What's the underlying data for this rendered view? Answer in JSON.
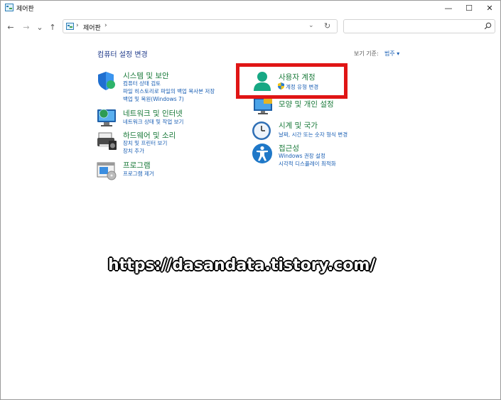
{
  "window": {
    "title": "제어판",
    "controls": {
      "minimize": "—",
      "maximize": "☐",
      "close": "✕"
    }
  },
  "nav": {
    "back": "←",
    "forward": "→",
    "recent": "⌄",
    "up": "↑"
  },
  "address": {
    "sep1": "›",
    "crumb": "제어판",
    "sep2": "›",
    "dropdown": "⌄",
    "refresh": "↻"
  },
  "search": {
    "placeholder": ""
  },
  "main": {
    "title": "컴퓨터 설정 변경",
    "view_by_label": "보기 기준:",
    "view_by_value": "범주 ▾"
  },
  "categories": {
    "system": {
      "title": "시스템 및 보안",
      "links": [
        "컴퓨터 상태 검토",
        "파일 히스토리로 파일의 백업 복사본 저장",
        "백업 및 복원(Windows 7)"
      ]
    },
    "network": {
      "title": "네트워크 및 인터넷",
      "links": [
        "네트워크 상태 및 작업 보기"
      ]
    },
    "hardware": {
      "title": "하드웨어 및 소리",
      "links": [
        "장치 및 프린터 보기",
        "장치 추가"
      ]
    },
    "programs": {
      "title": "프로그램",
      "links": [
        "프로그램 제거"
      ]
    },
    "accounts": {
      "title": "사용자 계정",
      "links": [
        "계정 유형 변경"
      ]
    },
    "appearance": {
      "title": "모양 및 개인 설정"
    },
    "clock": {
      "title": "시계 및 국가",
      "links": [
        "날짜, 시간 또는 숫자 형식 변경"
      ]
    },
    "access": {
      "title": "접근성",
      "links": [
        "Windows 권장 설정",
        "시각적 디스플레이 최적화"
      ]
    }
  },
  "watermark": "https://dasandata.tistory.com/",
  "colors": {
    "highlight": "#e01515",
    "link": "#1a5fb4",
    "category": "#1a7a3a"
  }
}
